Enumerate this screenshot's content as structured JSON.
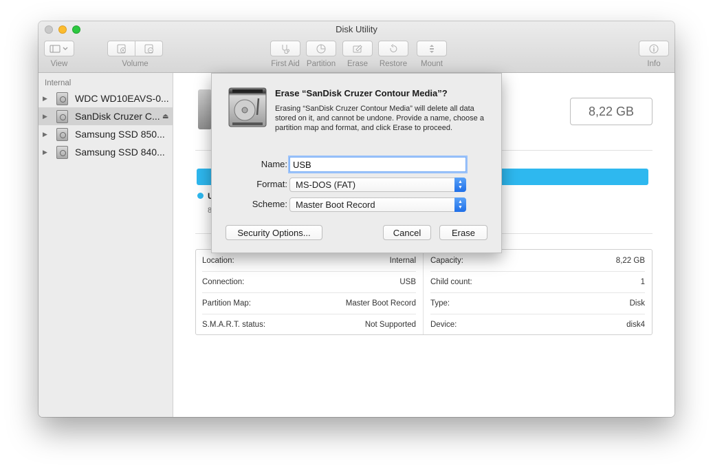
{
  "window": {
    "title": "Disk Utility"
  },
  "toolbar": {
    "view": {
      "label": "View",
      "icon": "sidebar-toggle-icon"
    },
    "volume": {
      "label": "Volume",
      "icons": [
        "add-volume-icon",
        "remove-volume-icon"
      ]
    },
    "first_aid": {
      "label": "First Aid",
      "icon": "stethoscope-icon"
    },
    "partition": {
      "label": "Partition",
      "icon": "pie-icon"
    },
    "erase": {
      "label": "Erase",
      "icon": "erase-icon"
    },
    "restore": {
      "label": "Restore",
      "icon": "restore-icon"
    },
    "mount": {
      "label": "Mount",
      "icon": "mount-icon"
    },
    "info": {
      "label": "Info",
      "icon": "info-icon"
    }
  },
  "sidebar": {
    "heading": "Internal",
    "items": [
      {
        "label": "WDC WD10EAVS-0...",
        "selected": false
      },
      {
        "label": "SanDisk Cruzer C...",
        "selected": true,
        "eject": "⏏"
      },
      {
        "label": "Samsung SSD 850...",
        "selected": false
      },
      {
        "label": "Samsung SSD 840...",
        "selected": false
      }
    ]
  },
  "main": {
    "capacity": "8,22 GB",
    "legend_name": "U",
    "legend_sub": "8",
    "usage_color": "#2eb8ef",
    "info": {
      "left": [
        {
          "label": "Location:",
          "value": "Internal"
        },
        {
          "label": "Connection:",
          "value": "USB"
        },
        {
          "label": "Partition Map:",
          "value": "Master Boot Record"
        },
        {
          "label": "S.M.A.R.T. status:",
          "value": "Not Supported"
        }
      ],
      "right": [
        {
          "label": "Capacity:",
          "value": "8,22 GB"
        },
        {
          "label": "Child count:",
          "value": "1"
        },
        {
          "label": "Type:",
          "value": "Disk"
        },
        {
          "label": "Device:",
          "value": "disk4"
        }
      ]
    }
  },
  "sheet": {
    "title": "Erase “SanDisk Cruzer Contour Media”?",
    "message": "Erasing “SanDisk Cruzer Contour Media” will delete all data stored on it, and cannot be undone. Provide a name, choose a partition map and format, and click Erase to proceed.",
    "name_label": "Name:",
    "name_value": "USB",
    "format_label": "Format:",
    "format_value": "MS-DOS (FAT)",
    "scheme_label": "Scheme:",
    "scheme_value": "Master Boot Record",
    "security_button": "Security Options...",
    "cancel_button": "Cancel",
    "erase_button": "Erase",
    "accent_color": "#1f6fe8"
  }
}
